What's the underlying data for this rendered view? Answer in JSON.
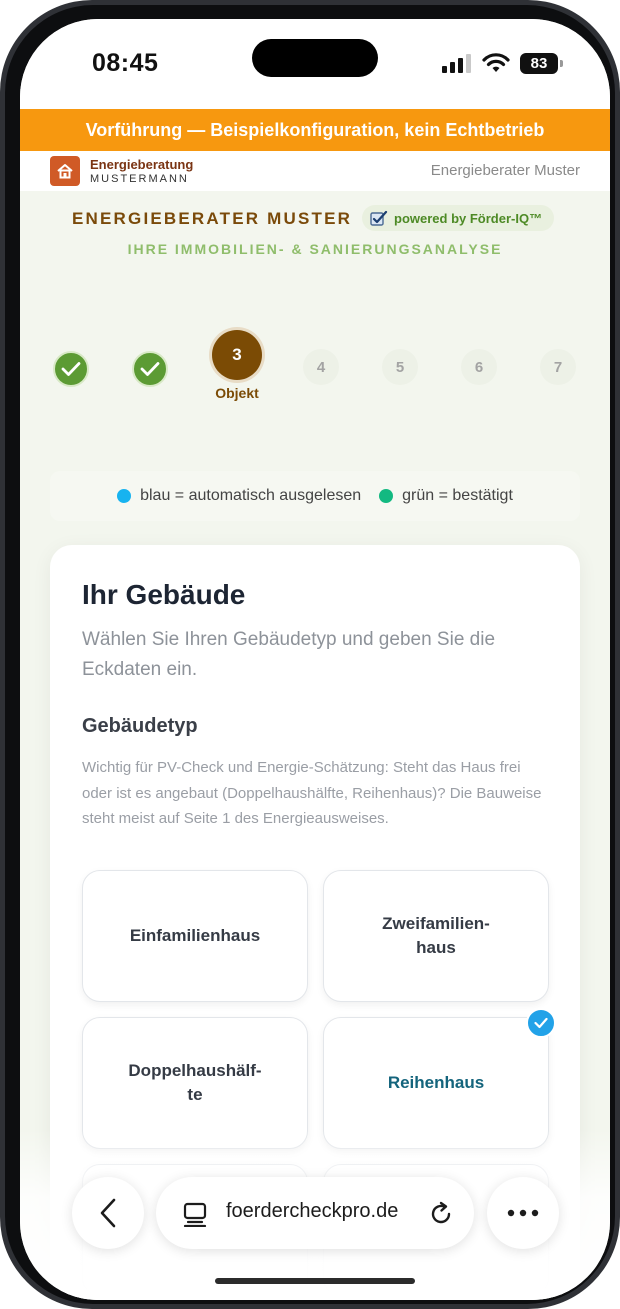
{
  "status_bar": {
    "time": "08:45",
    "battery": "83"
  },
  "demo_banner": "Vorführung — Beispielkonfiguration, kein Echtbetrieb",
  "brand": {
    "name": "Energieberatung",
    "sub": "MUSTERMANN",
    "advisor_link": "Energieberater Muster"
  },
  "header": {
    "title": "ENERGIEBERATER MUSTER",
    "powered_by": "powered by Förder-IQ™",
    "subtitle": "IHRE IMMOBILIEN- & SANIERUNGSANALYSE"
  },
  "stepper": {
    "current_step": "3",
    "current_label": "Objekt",
    "future_steps": [
      "4",
      "5",
      "6",
      "7"
    ]
  },
  "legend": {
    "blue": "blau = automatisch ausgelesen",
    "green": "grün = bestätigt",
    "blue_color": "#17b3f0",
    "green_color": "#13b981"
  },
  "card": {
    "title": "Ihr Gebäude",
    "description": "Wählen Sie Ihren Gebäudetyp und geben Sie die Eckdaten ein.",
    "section_title": "Gebäudetyp",
    "section_help": "Wichtig für PV-Check und Energie-Schätzung: Steht das Haus frei oder ist es angebaut (Doppelhaushälfte, Reihenhaus)? Die Bauweise steht meist auf Seite 1 des Energieausweises.",
    "building_types": [
      {
        "label": "Einfamilienhaus",
        "selected": false
      },
      {
        "label": "Zweifamilien-\nhaus",
        "selected": false
      },
      {
        "label": "Doppelhaushälf-\nte",
        "selected": false
      },
      {
        "label": "Reihenhaus",
        "selected": true
      }
    ]
  },
  "browser": {
    "url": "foerdercheckpro.de"
  },
  "colors": {
    "accent_orange": "#f7980f",
    "brand_brown": "#7b4b05",
    "step_done_green": "#5c9b34",
    "selected_check_blue": "#22a2e8"
  }
}
